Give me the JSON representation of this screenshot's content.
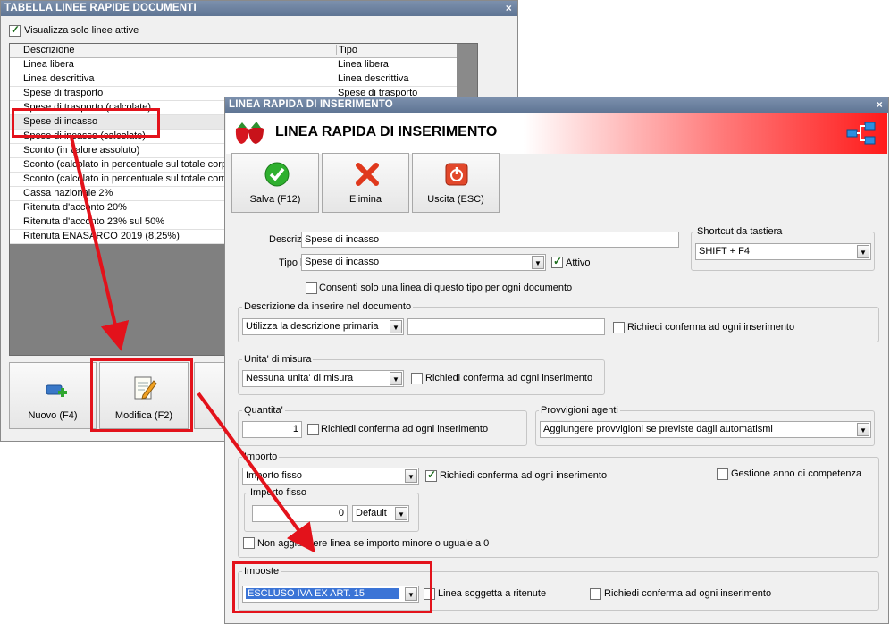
{
  "back_window": {
    "title": "TABELLA LINEE RAPIDE DOCUMENTI",
    "close_glyph": "×",
    "only_active_label": "Visualizza solo linee attive",
    "columns": [
      "Descrizione",
      "Tipo"
    ],
    "rows": [
      {
        "descrizione": "Linea libera",
        "tipo": "Linea libera"
      },
      {
        "descrizione": "Linea descrittiva",
        "tipo": "Linea descrittiva"
      },
      {
        "descrizione": "Spese di trasporto",
        "tipo": "Spese di trasporto"
      },
      {
        "descrizione": "Spese di trasporto (calcolate)",
        "tipo": ""
      },
      {
        "descrizione": "Spese di incasso",
        "tipo": ""
      },
      {
        "descrizione": "Spese di incasso (calcolate)",
        "tipo": ""
      },
      {
        "descrizione": "Sconto (in valore assoluto)",
        "tipo": ""
      },
      {
        "descrizione": "Sconto (calcolato in percentuale sul totale corpo",
        "tipo": ""
      },
      {
        "descrizione": "Sconto (calcolato in percentuale sul totale comp",
        "tipo": ""
      },
      {
        "descrizione": "Cassa nazionale 2%",
        "tipo": ""
      },
      {
        "descrizione": "Ritenuta d'acconto 20%",
        "tipo": ""
      },
      {
        "descrizione": "Ritenuta d'acconto 23% sul 50%",
        "tipo": ""
      },
      {
        "descrizione": "Ritenuta ENASARCO 2019 (8,25%)",
        "tipo": ""
      }
    ],
    "buttons": {
      "new": "Nuovo (F4)",
      "edit": "Modifica (F2)"
    }
  },
  "dialog": {
    "title": "LINEA RAPIDA DI INSERIMENTO",
    "close_glyph": "×",
    "header_title": "LINEA RAPIDA DI INSERIMENTO",
    "toolbar": {
      "save": "Salva (F12)",
      "delete": "Elimina",
      "exit": "Uscita (ESC)"
    },
    "descrizione_label": "Descrizione :",
    "descrizione_value": "Spese di incasso",
    "tipo_linea_label": "Tipo linea :",
    "tipo_linea_value": "Spese di incasso",
    "attivo_label": "Attivo",
    "shortcut_group": "Shortcut da tastiera",
    "shortcut_value": "SHIFT + F4",
    "una_linea_label": "Consenti solo una linea di questo tipo per ogni documento",
    "desc_group": "Descrizione da inserire nel documento",
    "desc_mode_value": "Utilizza la descrizione primaria",
    "desc_text_value": "",
    "richiedi_label": "Richiedi conferma ad ogni inserimento",
    "um_group": "Unita' di misura",
    "um_value": "Nessuna unita' di misura",
    "qty_group": "Quantita'",
    "qty_value": "1",
    "provv_group": "Provvigioni agenti",
    "provv_value": "Aggiungere provvigioni se previste dagli automatismi",
    "importo_group": "Importo",
    "importo_mode_value": "Importo fisso",
    "gestione_anno_label": "Gestione anno di competenza",
    "importo_fisso_group": "Importo fisso",
    "importo_fisso_value": "0",
    "importo_currency_value": "Default",
    "non_aggiungere_label": "Non aggiungere linea se importo minore o uguale a 0",
    "imposte_group": "Imposte",
    "imposte_value": "ESCLUSO IVA EX ART. 15",
    "ritenute_label": "Linea soggetta a ritenute"
  },
  "colors": {
    "highlight_red": "#e3121b",
    "title_bar": "#6b809e",
    "selection_blue": "#3b74d6"
  }
}
